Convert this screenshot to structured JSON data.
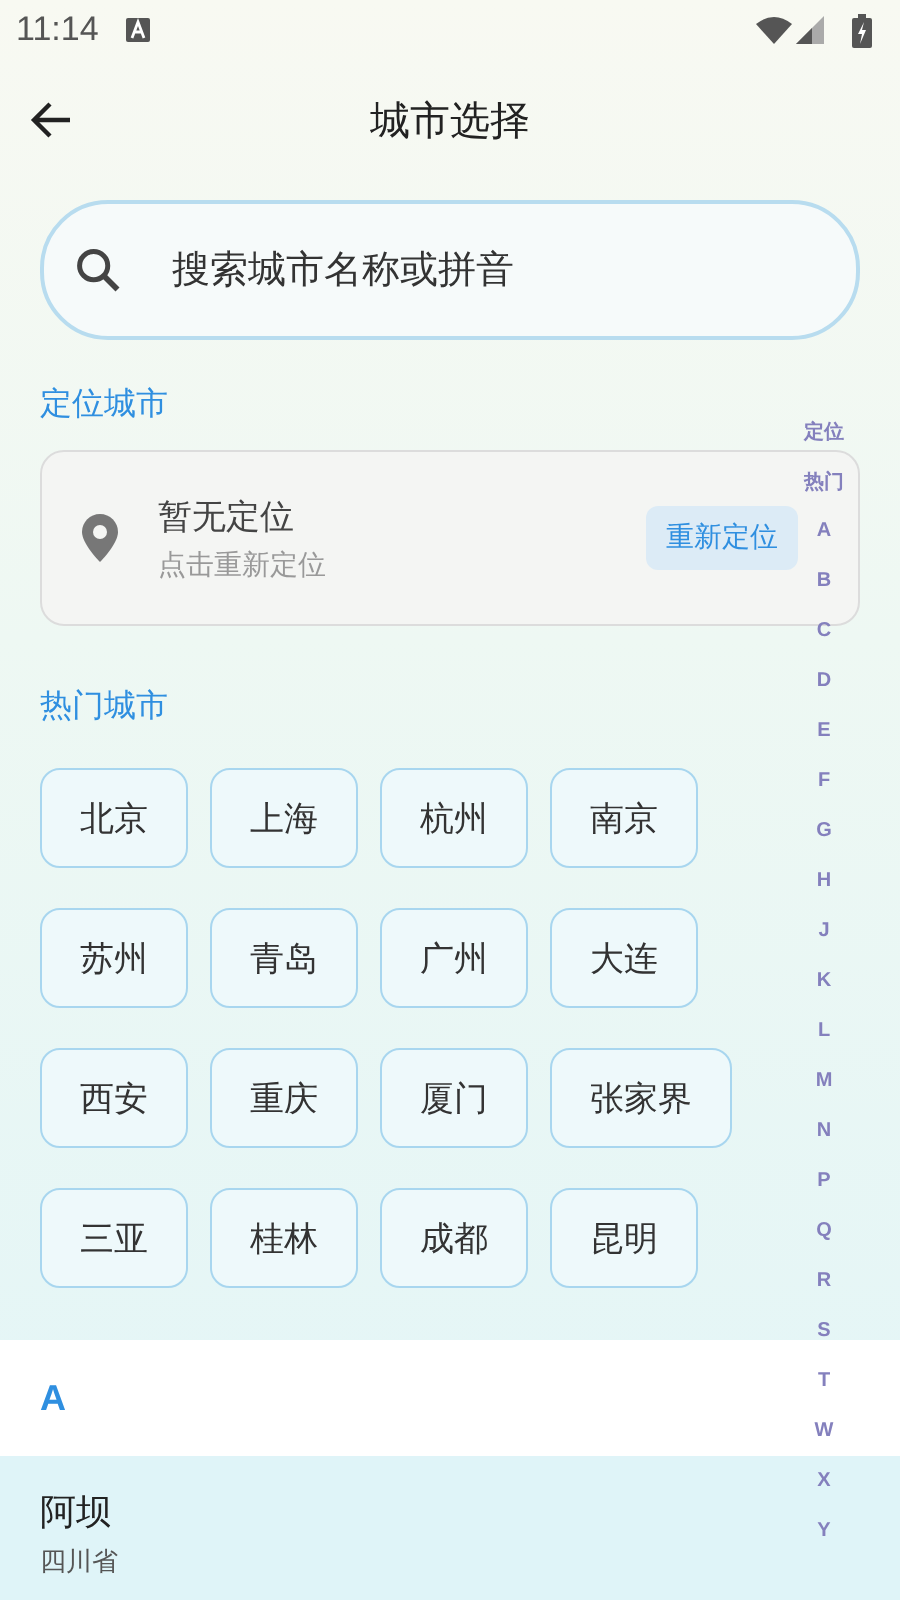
{
  "status_bar": {
    "time": "11:14"
  },
  "header": {
    "title": "城市选择"
  },
  "search": {
    "placeholder": "搜索城市名称或拼音"
  },
  "location_section": {
    "title": "定位城市",
    "status": "暂无定位",
    "hint": "点击重新定位",
    "button": "重新定位"
  },
  "hot_section": {
    "title": "热门城市",
    "cities": [
      "北京",
      "上海",
      "杭州",
      "南京",
      "苏州",
      "青岛",
      "广州",
      "大连",
      "西安",
      "重庆",
      "厦门",
      "张家界",
      "三亚",
      "桂林",
      "成都",
      "昆明"
    ]
  },
  "city_list": [
    {
      "letter": "A",
      "cities": [
        {
          "name": "阿坝",
          "province": "四川省"
        }
      ]
    }
  ],
  "index_bar": [
    "定位",
    "热门",
    "A",
    "B",
    "C",
    "D",
    "E",
    "F",
    "G",
    "H",
    "J",
    "K",
    "L",
    "M",
    "N",
    "P",
    "Q",
    "R",
    "S",
    "T",
    "W",
    "X",
    "Y"
  ]
}
